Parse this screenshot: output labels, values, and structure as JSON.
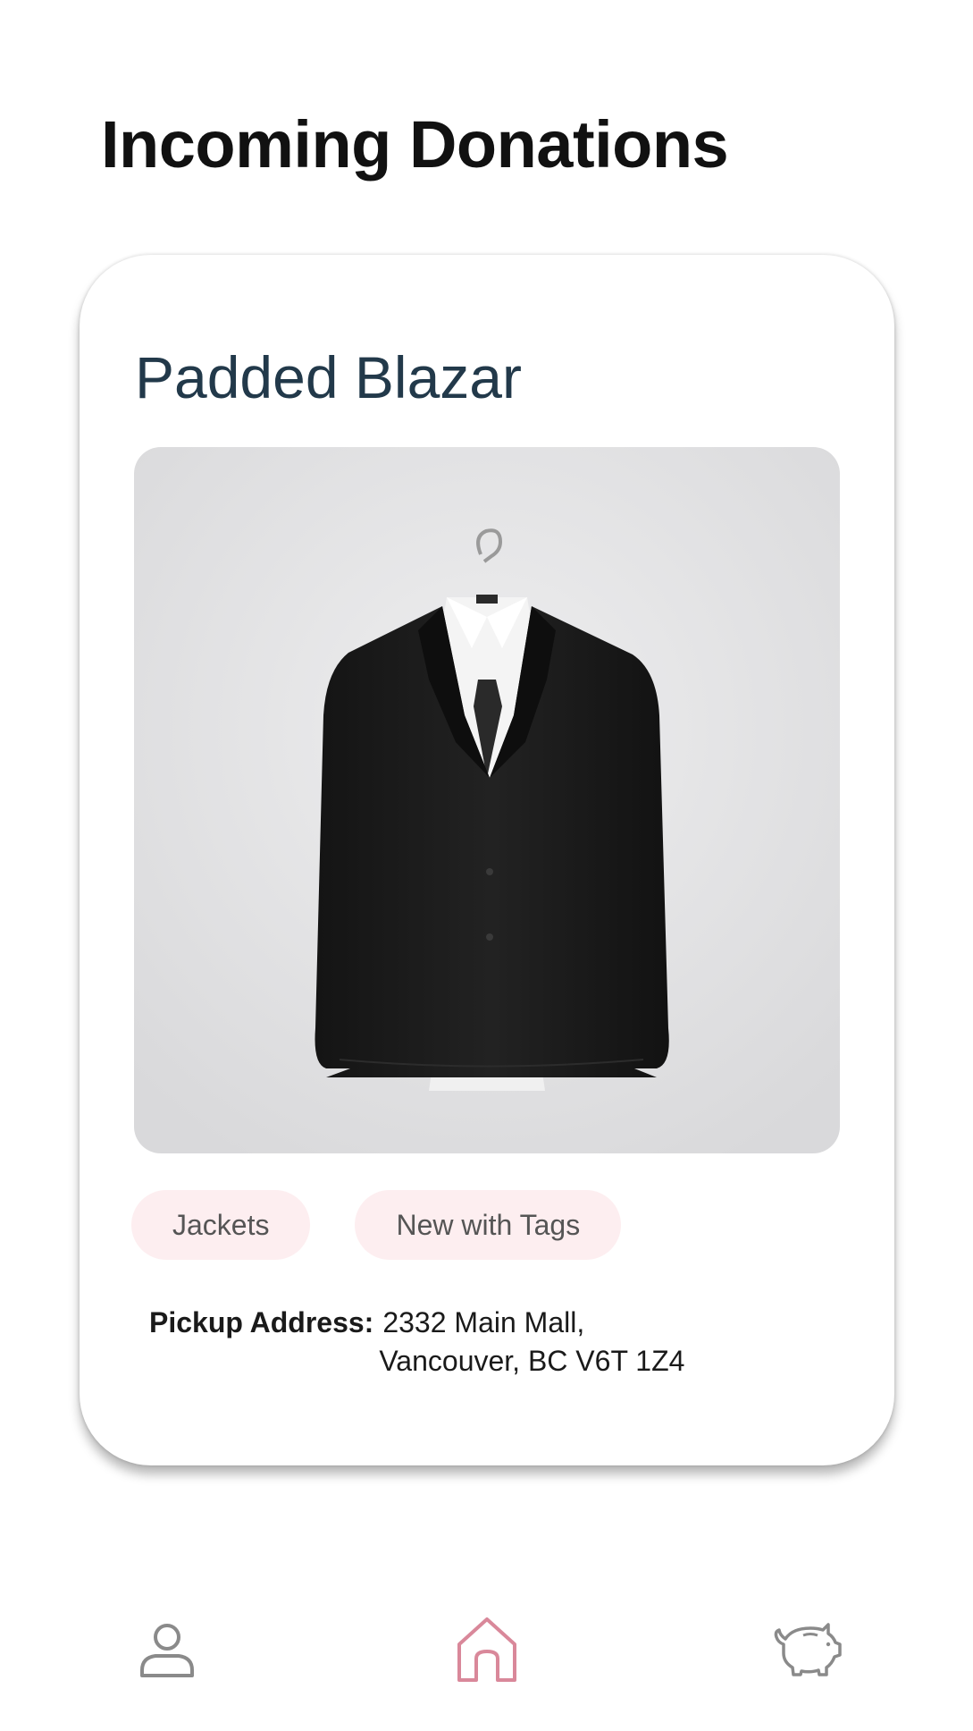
{
  "page": {
    "title": "Incoming Donations"
  },
  "donation": {
    "title": "Padded Blazar",
    "image_alt": "Black blazer on a hanger with a white shirt",
    "tags": [
      "Jackets",
      "New with Tags"
    ],
    "pickup_label": "Pickup Address:",
    "pickup_address_line1": "2332 Main Mall,",
    "pickup_address_line2": "Vancouver, BC V6T 1Z4"
  },
  "nav": {
    "items": [
      {
        "name": "profile",
        "icon": "person-icon",
        "active": false
      },
      {
        "name": "home",
        "icon": "home-icon",
        "active": true
      },
      {
        "name": "savings",
        "icon": "piggy-bank-icon",
        "active": false
      }
    ]
  },
  "colors": {
    "title": "#111111",
    "item_title": "#22394a",
    "tag_bg": "#fdeef0",
    "tag_text": "#555555",
    "nav_active": "#d9889a",
    "nav_inactive": "#8a8a8a"
  }
}
